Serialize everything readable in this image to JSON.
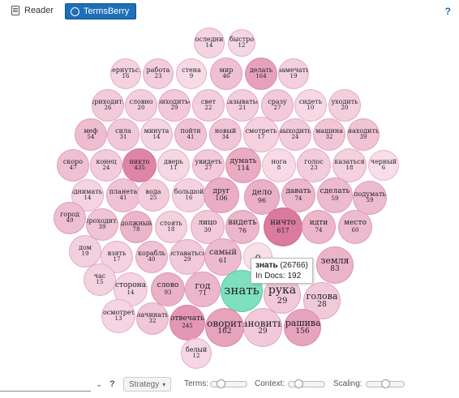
{
  "tabs": {
    "reader": "Reader",
    "terms": "TermsBerry"
  },
  "help_label": "?",
  "tooltip": {
    "term": "знать",
    "count": "(26766)",
    "docs_label": "In Docs:",
    "docs": "192"
  },
  "controls": {
    "strategy": "Strategy",
    "terms_label": "Terms:",
    "context_label": "Context:",
    "scaling_label": "Scaling:",
    "help": "?",
    "terms_value": 0.2,
    "context_value": 0.2,
    "scaling_value": 0.5
  },
  "colors": {
    "selected": "#7ee0bf",
    "accent": "#1e6fb8",
    "bubble_base": "#f6dbe5",
    "bubble_dark": "#e08fb0"
  },
  "bubbles": [
    {
      "word": "последний",
      "count": "14"
    },
    {
      "word": "быстро",
      "count": "12"
    },
    {
      "word": "вернуться",
      "count": "16"
    },
    {
      "word": "работа",
      "count": "23"
    },
    {
      "word": "стена",
      "count": "9"
    },
    {
      "word": "мир",
      "count": "46"
    },
    {
      "word": "делать",
      "count": "164"
    },
    {
      "word": "замечать",
      "count": "19"
    },
    {
      "word": "приходить",
      "count": "26"
    },
    {
      "word": "словно",
      "count": "20"
    },
    {
      "word": "приходиться",
      "count": "29"
    },
    {
      "word": "свет",
      "count": "22"
    },
    {
      "word": "оказываться",
      "count": "21"
    },
    {
      "word": "сразу",
      "count": "27"
    },
    {
      "word": "сидеть",
      "count": "10"
    },
    {
      "word": "уходить",
      "count": "20"
    },
    {
      "word": "меф",
      "count": "54"
    },
    {
      "word": "сила",
      "count": "31"
    },
    {
      "word": "минута",
      "count": "14"
    },
    {
      "word": "пойти",
      "count": "41"
    },
    {
      "word": "новый",
      "count": "34"
    },
    {
      "word": "смотреть",
      "count": "17"
    },
    {
      "word": "выходить",
      "count": "24"
    },
    {
      "word": "машина",
      "count": "32"
    },
    {
      "word": "находить",
      "count": "39"
    },
    {
      "word": "скоро",
      "count": "47"
    },
    {
      "word": "конец",
      "count": "24"
    },
    {
      "word": "никто",
      "count": "435"
    },
    {
      "word": "дверь",
      "count": "11"
    },
    {
      "word": "увидеть",
      "count": "27"
    },
    {
      "word": "думать",
      "count": "114"
    },
    {
      "word": "нога",
      "count": "8"
    },
    {
      "word": "голос",
      "count": "23"
    },
    {
      "word": "казаться",
      "count": "18"
    },
    {
      "word": "черный",
      "count": "6"
    },
    {
      "word": "подниматься",
      "count": "14"
    },
    {
      "word": "планета",
      "count": "41"
    },
    {
      "word": "вода",
      "count": "25"
    },
    {
      "word": "большой",
      "count": "16"
    },
    {
      "word": "друг",
      "count": "106"
    },
    {
      "word": "дело",
      "count": "96"
    },
    {
      "word": "давать",
      "count": "74"
    },
    {
      "word": "сделать",
      "count": "59"
    },
    {
      "word": "подумать",
      "count": "59"
    },
    {
      "word": "город",
      "count": "49"
    },
    {
      "word": "проходить",
      "count": "39"
    },
    {
      "word": "должный",
      "count": "78"
    },
    {
      "word": "стоять",
      "count": "18"
    },
    {
      "word": "лицо",
      "count": "30"
    },
    {
      "word": "видеть",
      "count": "76"
    },
    {
      "word": "ничто",
      "count": "617"
    },
    {
      "word": "идти",
      "count": "74"
    },
    {
      "word": "место",
      "count": "60"
    },
    {
      "word": "дом",
      "count": "19"
    },
    {
      "word": "взять",
      "count": "17"
    },
    {
      "word": "корабль",
      "count": "40"
    },
    {
      "word": "оставаться",
      "count": "29"
    },
    {
      "word": "самый",
      "count": "61"
    },
    {
      "word": "о",
      "count": ""
    },
    {
      "word": "земля",
      "count": "83"
    },
    {
      "word": "час",
      "count": "15"
    },
    {
      "word": "сторона",
      "count": "14"
    },
    {
      "word": "слово",
      "count": "93"
    },
    {
      "word": "год",
      "count": "71"
    },
    {
      "word": "знать",
      "count": ""
    },
    {
      "word": "рука",
      "count": "29"
    },
    {
      "word": "голова",
      "count": "28"
    },
    {
      "word": "посмотреть",
      "count": "13"
    },
    {
      "word": "начинать",
      "count": "32"
    },
    {
      "word": "отвечать",
      "count": "245"
    },
    {
      "word": "говорить",
      "count": "162"
    },
    {
      "word": "становиться",
      "count": "29"
    },
    {
      "word": "спрашивать",
      "count": "156"
    },
    {
      "word": "белый",
      "count": "12"
    }
  ]
}
